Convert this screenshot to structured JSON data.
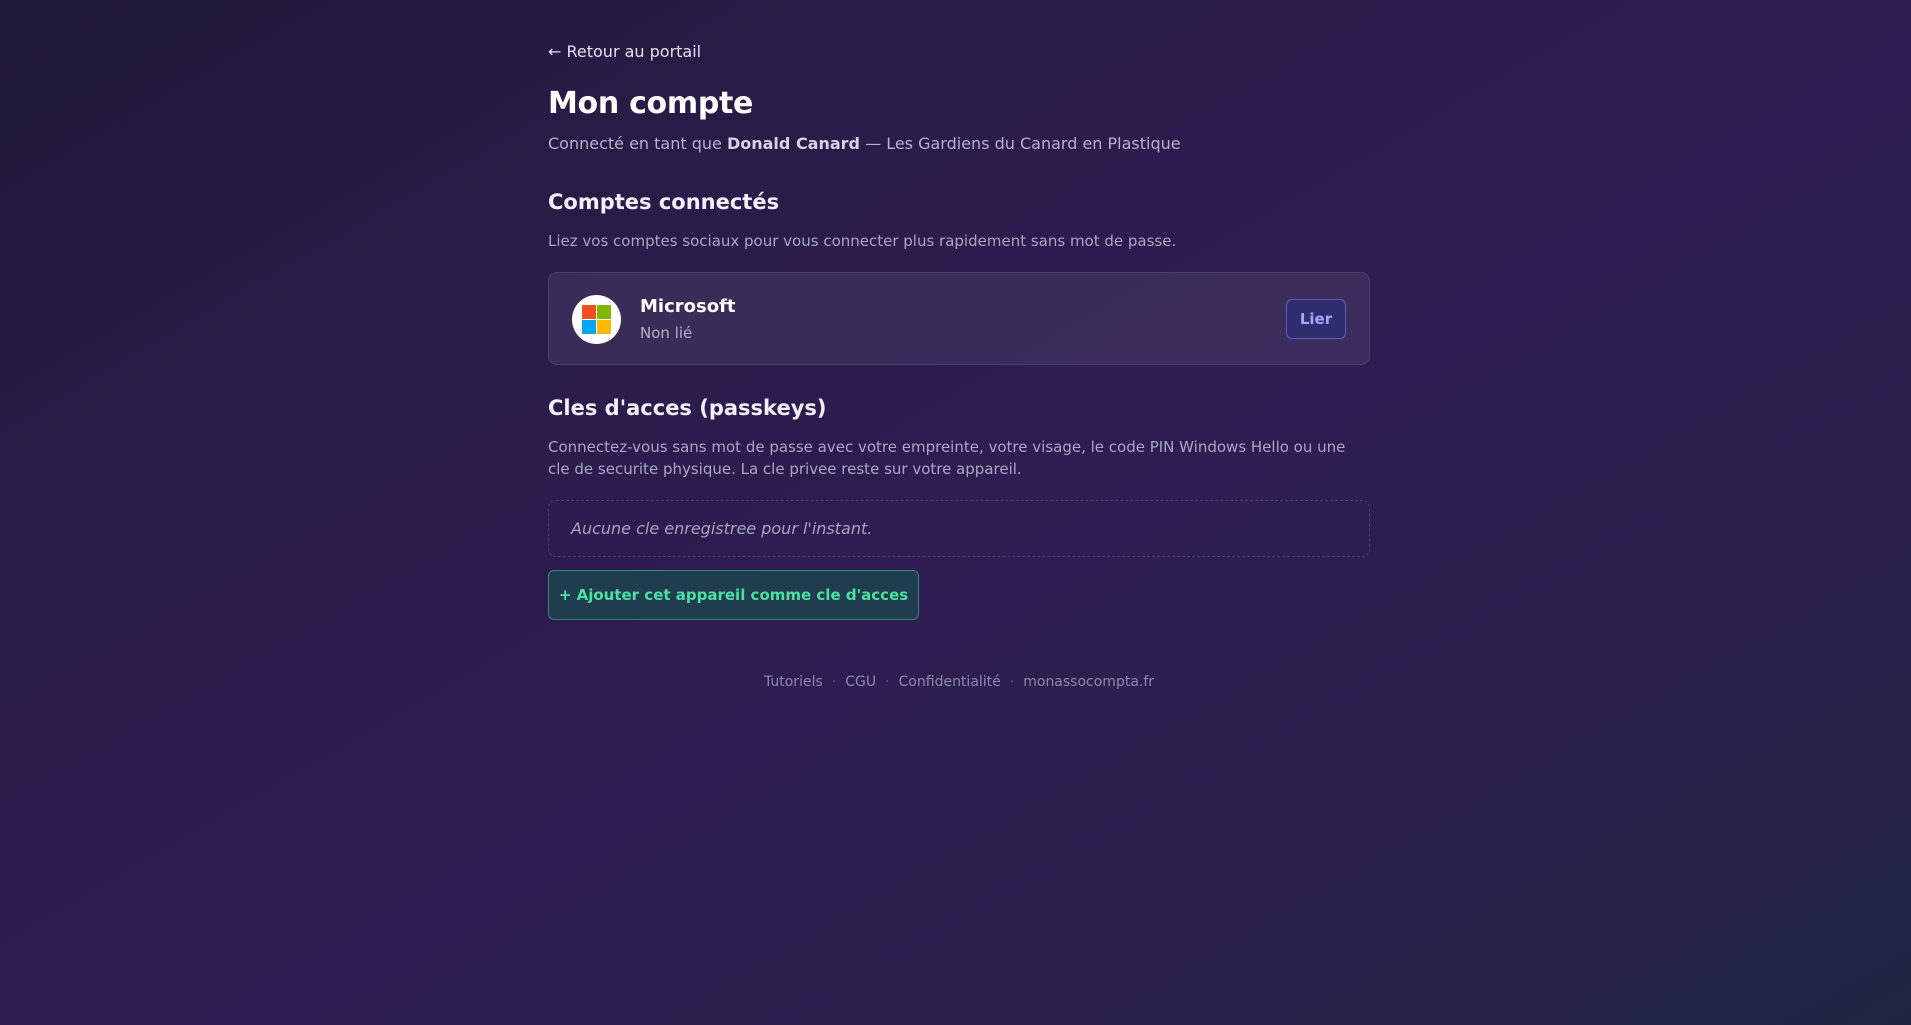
{
  "nav": {
    "back_label": "← Retour au portail"
  },
  "header": {
    "title": "Mon compte",
    "connected_prefix": "Connecté en tant que",
    "user_name": "Donald Canard",
    "separator": "—",
    "organization": "Les Gardiens du Canard en Plastique"
  },
  "connected_accounts": {
    "title": "Comptes connectés",
    "description": "Liez vos comptes sociaux pour vous connecter plus rapidement sans mot de passe.",
    "providers": [
      {
        "name": "Microsoft",
        "status": "Non lié",
        "action_label": "Lier",
        "icon": "microsoft-logo-icon",
        "logo_colors": [
          "#f25022",
          "#7fba00",
          "#00a4ef",
          "#ffb900"
        ]
      }
    ]
  },
  "passkeys": {
    "title": "Cles d'acces (passkeys)",
    "description": "Connectez-vous sans mot de passe avec votre empreinte, votre visage, le code PIN Windows Hello ou une cle de securite physique. La cle privee reste sur votre appareil.",
    "empty_message": "Aucune cle enregistree pour l'instant.",
    "add_label": "+ Ajouter cet appareil comme cle d'acces"
  },
  "footer": {
    "links": [
      "Tutoriels",
      "CGU",
      "Confidentialité",
      "monassocompta.fr"
    ],
    "separator": "·"
  },
  "colors": {
    "accent_link_button": "#a9a6ff",
    "accent_add_button": "#4be0a3"
  }
}
